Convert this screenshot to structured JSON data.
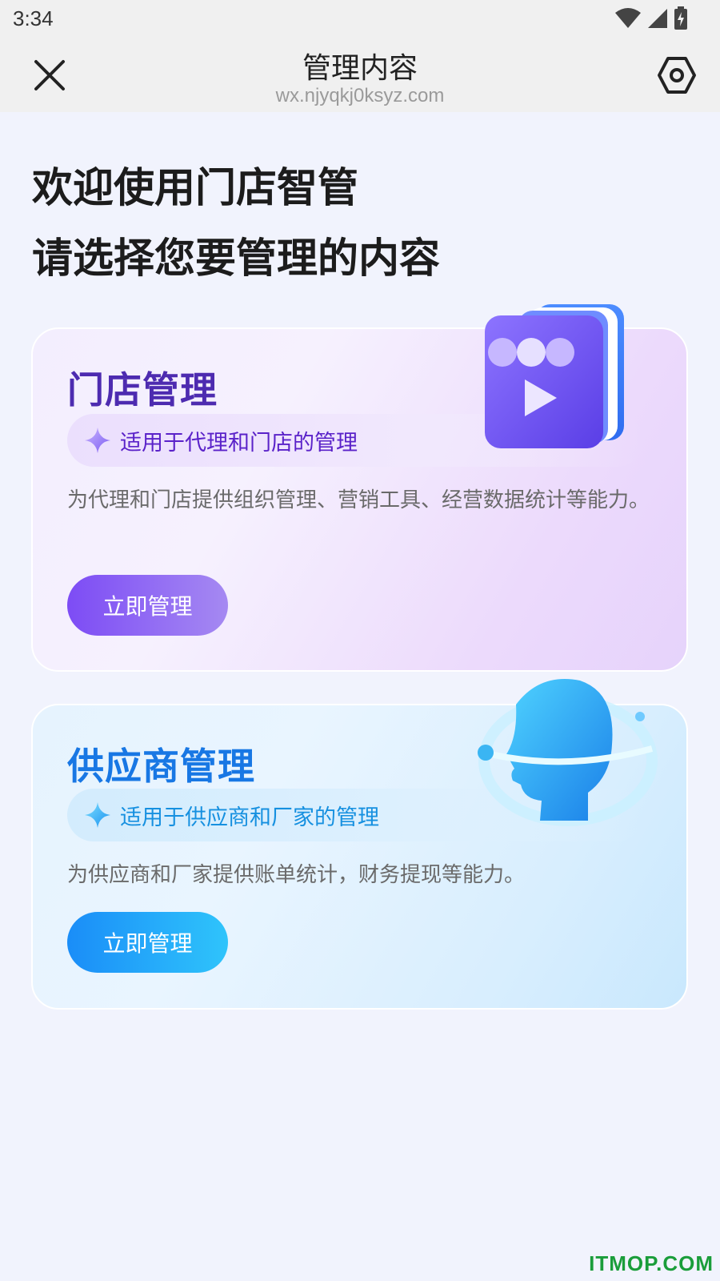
{
  "status_bar": {
    "time": "3:34"
  },
  "nav": {
    "title": "管理内容",
    "subtitle": "wx.njyqkj0ksyz.com"
  },
  "welcome": {
    "line1": "欢迎使用门店智管",
    "line2": "请选择您要管理的内容"
  },
  "cards": [
    {
      "title": "门店管理",
      "tag": "适用于代理和门店的管理",
      "description": "为代理和门店提供组织管理、营销工具、经营数据统计等能力。",
      "button": "立即管理",
      "illustration": "store-play-icon"
    },
    {
      "title": "供应商管理",
      "tag": "适用于供应商和厂家的管理",
      "description": "为供应商和厂家提供账单统计，财务提现等能力。",
      "button": "立即管理",
      "illustration": "head-orbit-icon"
    }
  ],
  "watermark": "ITMOP.COM",
  "colors": {
    "store_accent": "#7d4cf5",
    "supplier_accent": "#1a8df8",
    "background": "#f1f3fd"
  }
}
